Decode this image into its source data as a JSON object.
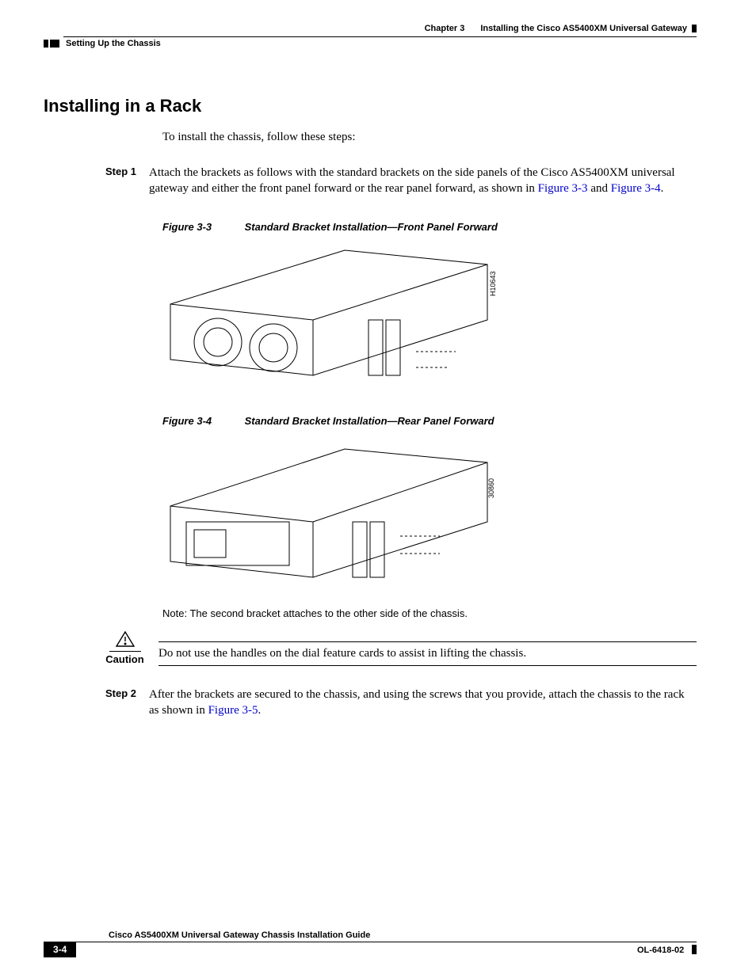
{
  "header": {
    "chapter_label": "Chapter 3",
    "chapter_title": "Installing the Cisco AS5400XM Universal Gateway",
    "section": "Setting Up the Chassis"
  },
  "heading": "Installing in a Rack",
  "intro": "To install the chassis, follow these steps:",
  "step1": {
    "label": "Step 1",
    "text_a": "Attach the brackets as follows with the standard brackets on the side panels of the Cisco AS5400XM universal gateway and either the front panel forward or the rear panel forward, as shown in ",
    "link_a": "Figure 3-3",
    "text_b": " and ",
    "link_b": "Figure 3-4",
    "text_c": "."
  },
  "fig3": {
    "num": "Figure 3-3",
    "title": "Standard Bracket Installation—Front Panel Forward",
    "code": "H10643"
  },
  "fig4": {
    "num": "Figure 3-4",
    "title": "Standard Bracket Installation—Rear Panel Forward",
    "code": "30860"
  },
  "note": "Note: The second bracket attaches to the other side of the chassis.",
  "caution": {
    "label": "Caution",
    "text": "Do not use the handles on the dial feature cards to assist in lifting the chassis."
  },
  "step2": {
    "label": "Step 2",
    "text_a": "After the brackets are secured to the chassis, and using the screws that you provide, attach the chassis to the rack as shown in ",
    "link_a": "Figure 3-5",
    "text_b": "."
  },
  "footer": {
    "doc_title": "Cisco AS5400XM Universal Gateway Chassis Installation Guide",
    "page": "3-4",
    "doc_id": "OL-6418-02"
  }
}
